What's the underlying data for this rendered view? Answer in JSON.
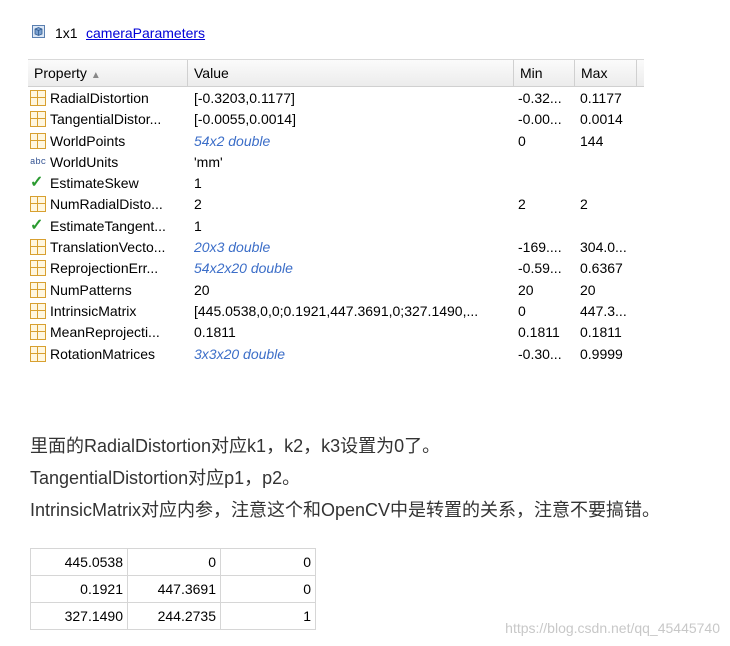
{
  "header": {
    "size": "1x1",
    "class_name": "cameraParameters"
  },
  "columns": {
    "property": "Property",
    "value": "Value",
    "min": "Min",
    "max": "Max"
  },
  "rows": [
    {
      "icon": "grid-icon",
      "name": "RadialDistortion",
      "value": "[-0.3203,0.1177]",
      "min": "-0.32...",
      "max": "0.1177"
    },
    {
      "icon": "grid-icon",
      "name": "TangentialDistor...",
      "value": "[-0.0055,0.0014]",
      "min": "-0.00...",
      "max": "0.0014"
    },
    {
      "icon": "grid-icon",
      "name": "WorldPoints",
      "value": "54x2 double",
      "min": "0",
      "max": "144"
    },
    {
      "icon": "abc-icon",
      "name": "WorldUnits",
      "value": "'mm'",
      "min": "",
      "max": ""
    },
    {
      "icon": "checkbox-icon",
      "name": "EstimateSkew",
      "value": "1",
      "min": "",
      "max": ""
    },
    {
      "icon": "grid-icon",
      "name": "NumRadialDisto...",
      "value": "2",
      "min": "2",
      "max": "2"
    },
    {
      "icon": "checkbox-icon",
      "name": "EstimateTangent...",
      "value": "1",
      "min": "",
      "max": ""
    },
    {
      "icon": "grid-icon",
      "name": "TranslationVecto...",
      "value": "20x3 double",
      "min": "-169....",
      "max": "304.0..."
    },
    {
      "icon": "grid-icon",
      "name": "ReprojectionErr...",
      "value": "54x2x20 double",
      "min": "-0.59...",
      "max": "0.6367"
    },
    {
      "icon": "grid-icon",
      "name": "NumPatterns",
      "value": "20",
      "min": "20",
      "max": "20"
    },
    {
      "icon": "grid-icon",
      "name": "IntrinsicMatrix",
      "value": "[445.0538,0,0;0.1921,447.3691,0;327.1490,...",
      "min": "0",
      "max": "447.3..."
    },
    {
      "icon": "grid-icon",
      "name": "MeanReprojecti...",
      "value": "0.1811",
      "min": "0.1811",
      "max": "0.1811"
    },
    {
      "icon": "grid-icon",
      "name": "RotationMatrices",
      "value": "3x3x20 double",
      "min": "-0.30...",
      "max": "0.9999"
    }
  ],
  "notes": [
    "里面的RadialDistortion对应k1，k2，k3设置为0了。",
    "TangentialDistortion对应p1，p2。",
    "IntrinsicMatrix对应内参，注意这个和OpenCV中是转置的关系，注意不要搞错。"
  ],
  "matrix": [
    [
      "445.0538",
      "0",
      "0"
    ],
    [
      "0.1921",
      "447.3691",
      "0"
    ],
    [
      "327.1490",
      "244.2735",
      "1"
    ]
  ],
  "watermark": "https://blog.csdn.net/qq_45445740"
}
